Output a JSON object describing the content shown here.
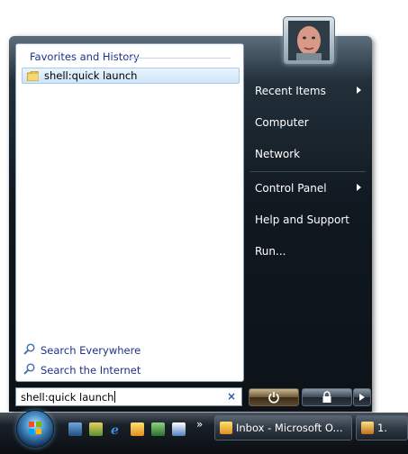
{
  "left_pane": {
    "header": "Favorites and History",
    "results": [
      {
        "label": "shell:quick launch",
        "icon": "folder-icon"
      }
    ],
    "search_links": [
      {
        "label": "Search Everywhere",
        "icon": "search-icon"
      },
      {
        "label": "Search the Internet",
        "icon": "search-icon"
      }
    ]
  },
  "search": {
    "value": "shell:quick launch",
    "clear_icon": "×"
  },
  "right_pane": {
    "items": [
      {
        "label": "Recent Items",
        "has_submenu": true
      },
      {
        "label": "Computer",
        "has_submenu": false
      },
      {
        "label": "Network",
        "has_submenu": false
      },
      {
        "label": "Control Panel",
        "has_submenu": true
      },
      {
        "label": "Help and Support",
        "has_submenu": false
      },
      {
        "label": "Run...",
        "has_submenu": false
      }
    ]
  },
  "power": {
    "power_icon": "power-icon",
    "lock_icon": "lock-icon",
    "options_icon": "arrow-right-icon"
  },
  "taskbar": {
    "chevron": "»",
    "buttons": [
      {
        "label": "Inbox - Microsoft O...",
        "icon": "outlook-icon"
      },
      {
        "label": "1.",
        "icon": "app-icon"
      }
    ]
  },
  "colors": {
    "link_blue": "#1e3287",
    "menu_dark": "#101820",
    "highlight": "#cfe5f9"
  }
}
